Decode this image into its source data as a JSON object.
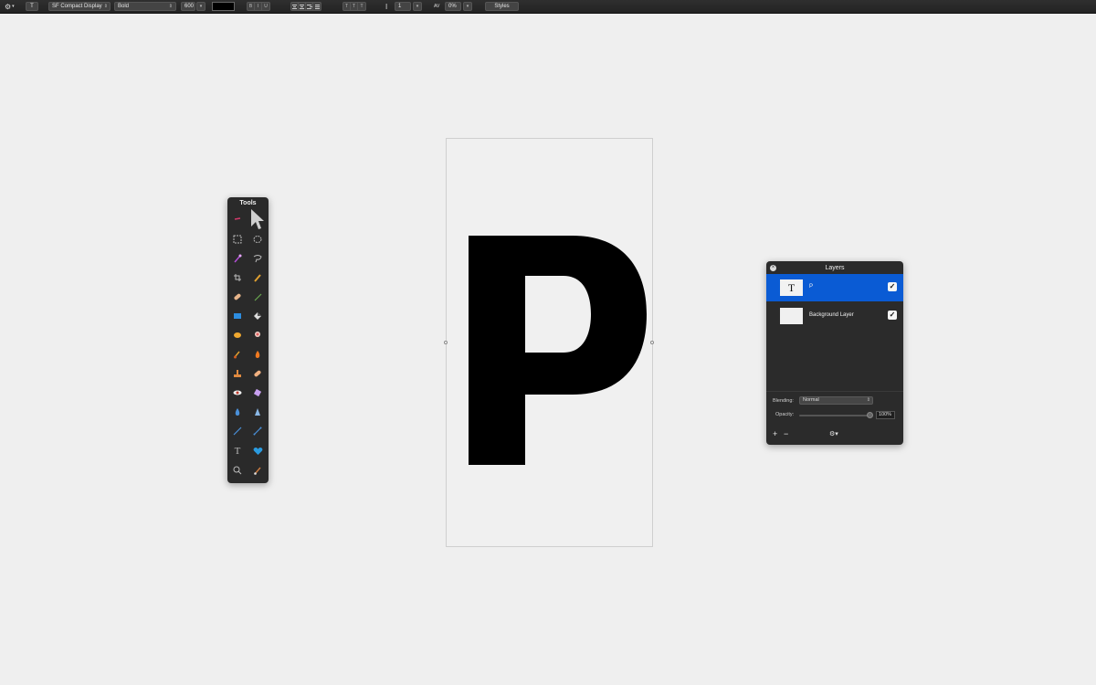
{
  "toolbar": {
    "gear_menu": "⚙",
    "type_menu": "T",
    "font_family": "SF Compact Display",
    "font_style": "Bold",
    "font_size": "600",
    "text_color": "#000000",
    "style_buttons": [
      "B",
      "I",
      "U"
    ],
    "baseline_buttons": [
      "T",
      "T",
      "T"
    ],
    "line_spacing": "1",
    "tracking": "0%",
    "tracking_label": "AV",
    "styles_button": "Styles"
  },
  "canvas": {
    "glyph": "P"
  },
  "tools_palette": {
    "title": "Tools",
    "items": [
      "color-sampler-icon",
      "arrow-pointer-icon",
      "rectangle-select-icon",
      "ellipse-select-icon",
      "magic-wand-icon",
      "lasso-icon",
      "crop-icon",
      "eyedropper-icon",
      "bandage-icon",
      "pencil-icon",
      "paint-bucket-icon",
      "gradient-icon",
      "sponge-icon",
      "smudge-icon",
      "brush-icon",
      "burn-icon",
      "clone-stamp-icon",
      "heal-icon",
      "red-eye-icon",
      "eraser-icon",
      "water-drop-icon",
      "sharpen-icon",
      "line-icon",
      "pen-icon",
      "text-tool-icon",
      "shape-heart-icon",
      "zoom-icon",
      "paint-brush-icon"
    ]
  },
  "layers_panel": {
    "title": "Layers",
    "layers": [
      {
        "name": "P",
        "thumb": "T",
        "visible": true,
        "selected": true
      },
      {
        "name": "Background Layer",
        "thumb": "",
        "visible": true,
        "selected": false
      }
    ],
    "blending_label": "Blending:",
    "blending_value": "Normal",
    "opacity_label": "Opacity:",
    "opacity_value": "100%",
    "add_button": "+",
    "remove_button": "−",
    "gear_button": "⚙▾"
  },
  "colors": {
    "selected_layer": "#0a5bd4",
    "panel_bg": "#2b2b2b",
    "canvas_bg": "#efefef"
  }
}
